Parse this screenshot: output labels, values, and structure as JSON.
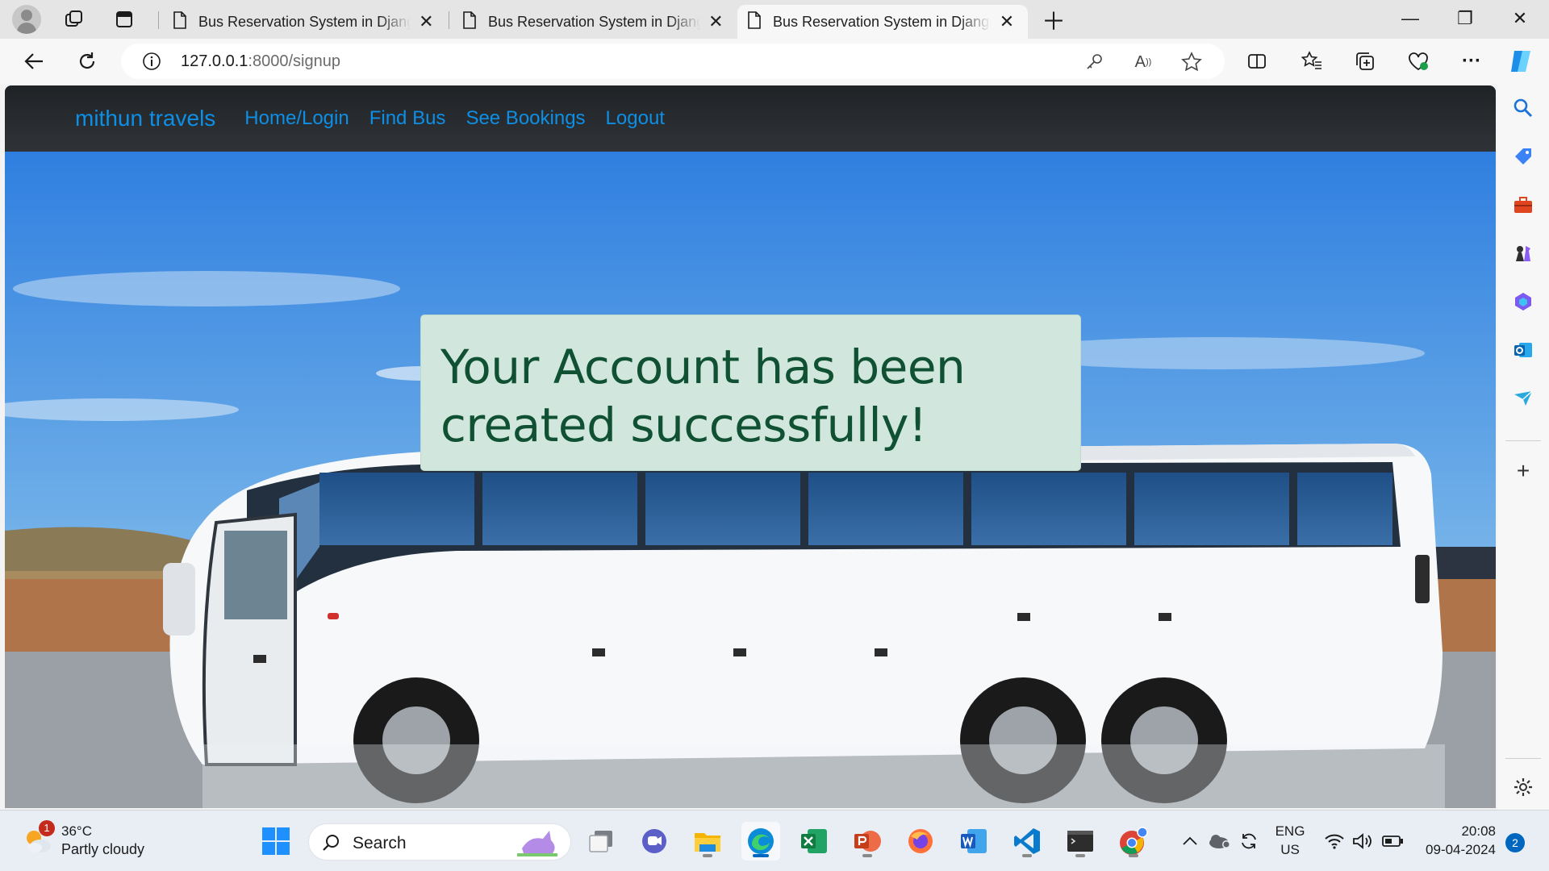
{
  "browser": {
    "tabs": [
      {
        "title": "Bus Reservation System in Django"
      },
      {
        "title": "Bus Reservation System in Django"
      },
      {
        "title": "Bus Reservation System in Django"
      }
    ],
    "url_host": "127.0.0.1",
    "url_rest": ":8000/signup",
    "window_controls": {
      "minimize": "—",
      "restore": "❐",
      "close": "✕"
    }
  },
  "page": {
    "brand": "mithun travels",
    "nav_links": [
      "Home/Login",
      "Find Bus",
      "See Bookings",
      "Logout"
    ],
    "alert_line1": "Your Account has been",
    "alert_line2": "created successfully!",
    "colors": {
      "navbar_bg": "#212529",
      "link": "#0d8fe6",
      "alert_bg": "#d1e7dd",
      "alert_text": "#0f5132"
    }
  },
  "taskbar": {
    "weather_temp": "36°C",
    "weather_condition": "Partly cloudy",
    "weather_badge": "1",
    "search_label": "Search",
    "language_line1": "ENG",
    "language_line2": "US",
    "time": "20:08",
    "date": "09-04-2024",
    "notification_count": "2"
  }
}
